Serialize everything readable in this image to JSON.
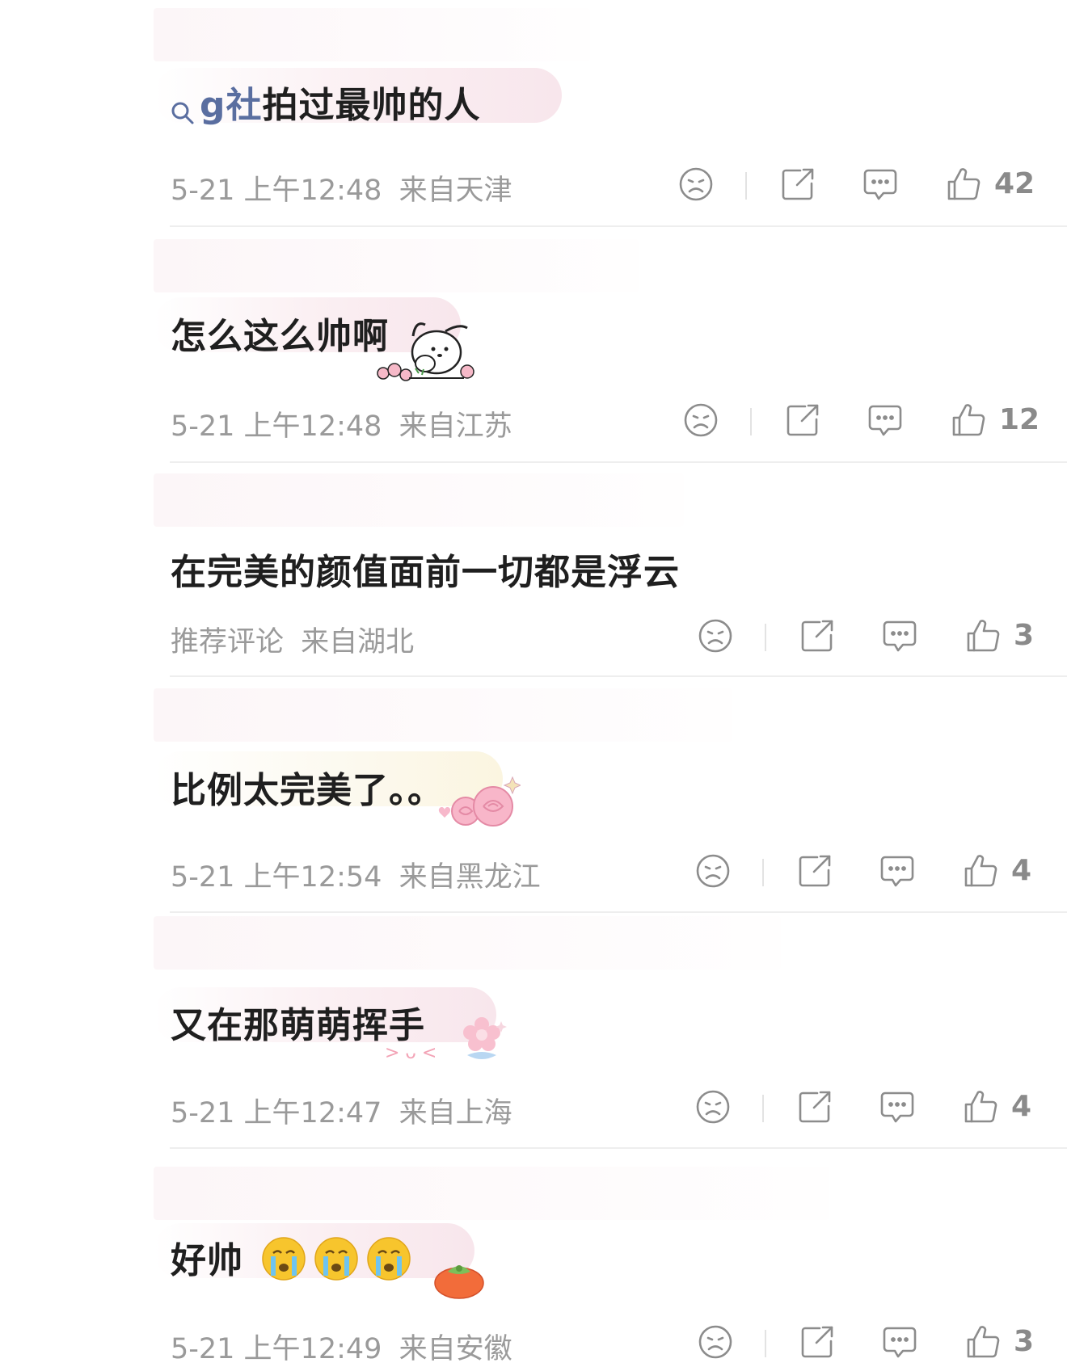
{
  "comments": [
    {
      "search_prefix": "g社",
      "text": "拍过最帅的人",
      "date": "5-21 上午12:48",
      "location": "来自天津",
      "likes": "42"
    },
    {
      "text": "怎么这么帅啊",
      "date": "5-21 上午12:48",
      "location": "来自江苏",
      "likes": "12"
    },
    {
      "text": "在完美的颜值面前一切都是浮云",
      "date": "推荐评论",
      "location": "来自湖北",
      "likes": "3"
    },
    {
      "text": "比例太完美了。。",
      "date": "5-21 上午12:54",
      "location": "来自黑龙江",
      "likes": "4"
    },
    {
      "text": "又在那萌萌挥手",
      "date": "5-21 上午12:47",
      "location": "来自上海",
      "likes": "4"
    },
    {
      "text": "好帅",
      "date": "5-21 上午12:49",
      "location": "来自安徽",
      "likes": "3"
    }
  ],
  "colors": {
    "search_accent": "#5a6ea0",
    "meta_text": "#9a9a9a",
    "icon_stroke": "#8c8c8c"
  },
  "icons": [
    "dislike-face-icon",
    "share-icon",
    "reply-icon",
    "thumbs-up-icon",
    "search-icon"
  ]
}
